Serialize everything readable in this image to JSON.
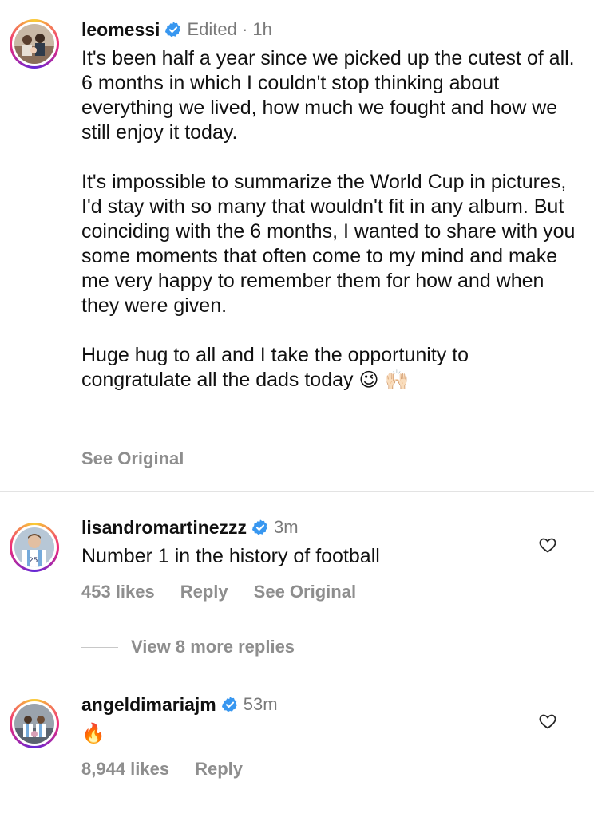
{
  "post": {
    "username": "leomessi",
    "edited": "Edited · 1h",
    "paragraph_1": "It's been half a year since we picked up the cutest of all. 6 months in which I couldn't stop thinking about everything we lived, how much we fought and how we still enjoy it today.",
    "paragraph_2": "It's impossible to summarize the World Cup in pictures, I'd stay with so many that wouldn't fit in any album. But coinciding with the 6 months, I wanted to share with you some moments that often come to my mind and make me very happy to remember them for how and when they were given.",
    "paragraph_3": "Huge hug to all and I take the opportunity to congratulate all the dads today",
    "paragraph_3_emoji": "😉 🙌🏻",
    "see_original": "See Original"
  },
  "comments": [
    {
      "username": "lisandromartinezzz",
      "time": "3m",
      "text": "Number 1 in the history of football",
      "likes": "453 likes",
      "reply": "Reply",
      "see_original": "See Original"
    },
    {
      "username": "angeldimariajm",
      "time": "53m",
      "text": "🔥",
      "likes": "8,944 likes",
      "reply": "Reply"
    }
  ],
  "view_more_replies": "View 8 more replies",
  "icons": {
    "verified": "verified-badge-icon",
    "like": "heart-icon"
  },
  "colors": {
    "verified": "#3897f0",
    "secondary_text": "#8e8e8e"
  }
}
